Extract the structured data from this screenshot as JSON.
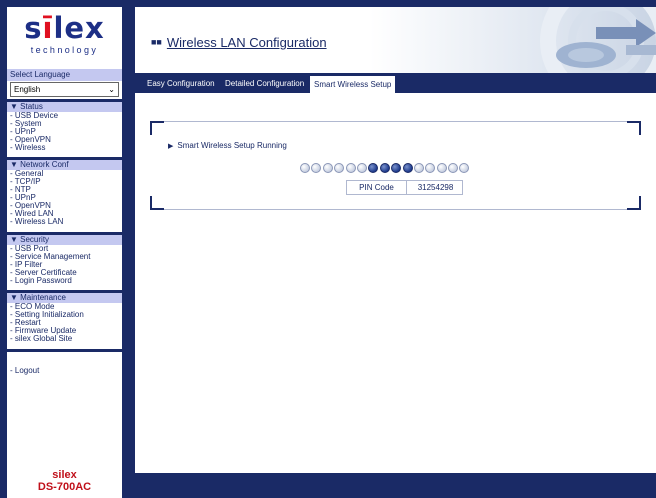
{
  "sidebar": {
    "logo": {
      "word_start": "s",
      "word_i": "ī",
      "word_end": "lex",
      "subtitle": "technology"
    },
    "language": {
      "label": "Select Language",
      "selected": "English"
    },
    "groups": [
      {
        "title": "▼ Status",
        "items": [
          "- USB Device",
          "- System",
          "- UPnP",
          "- OpenVPN",
          "- Wireless"
        ]
      },
      {
        "title": "▼ Network Conf",
        "items": [
          "- General",
          "- TCP/IP",
          "- NTP",
          "- UPnP",
          "- OpenVPN",
          "- Wired LAN",
          "- Wireless LAN"
        ]
      },
      {
        "title": "▼ Security",
        "items": [
          "- USB Port",
          "- Service Management",
          "- IP Filter",
          "- Server Certificate",
          "- Login Password"
        ]
      },
      {
        "title": "▼ Maintenance",
        "items": [
          "- ECO Mode",
          "- Setting Initialization",
          "- Restart",
          "- Firmware Update",
          "- silex Global Site"
        ]
      }
    ],
    "logout": "- Logout",
    "product": {
      "brand": "silex",
      "model": "DS-700AC"
    }
  },
  "header": {
    "title": "Wireless LAN Configuration"
  },
  "tabs": [
    {
      "label": "Easy Configuration",
      "active": false
    },
    {
      "label": "Detailed Configuration",
      "active": false
    },
    {
      "label": "Smart Wireless Setup",
      "active": true
    }
  ],
  "panel": {
    "status": "Smart Wireless Setup Running",
    "progress": {
      "total_dots": 15,
      "active_dots": [
        6,
        7,
        8,
        9
      ]
    },
    "pin_label": "PIN Code",
    "pin_value": "31254298"
  },
  "colors": {
    "navy": "#1a2a66",
    "sidebar_group_bg": "#c4c8f0",
    "product_red": "#c0101a",
    "logo_blue": "#1d2f86"
  }
}
